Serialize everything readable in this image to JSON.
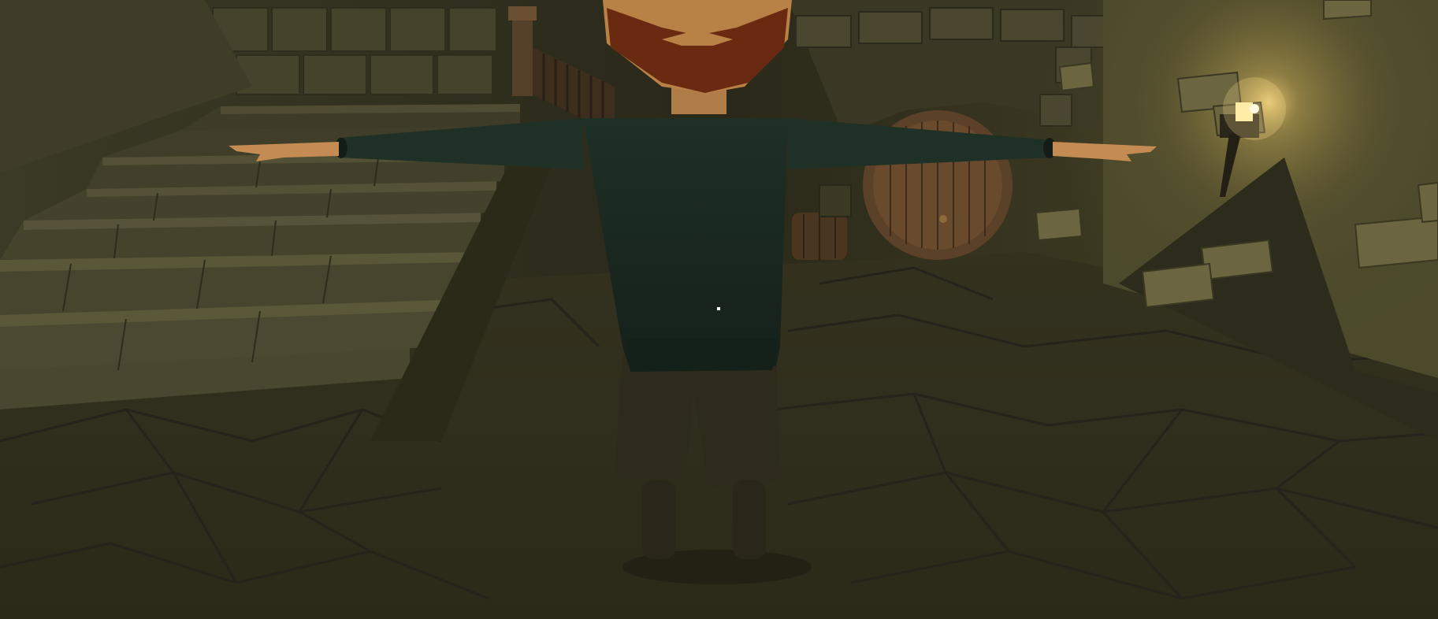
{
  "scene": {
    "name": "dungeon-cellar",
    "light_color": "#ffd978",
    "ambient_color": "#3a3620",
    "floor_color": "#3e3b27",
    "wall_color": "#4c4a30",
    "character": {
      "pose": "t-pose",
      "shirt_color": "#1c2b22",
      "beard_color": "#6a2a12",
      "skin_color": "#c9935a"
    }
  },
  "hud": {
    "crosshair": "crosshair-dot"
  }
}
